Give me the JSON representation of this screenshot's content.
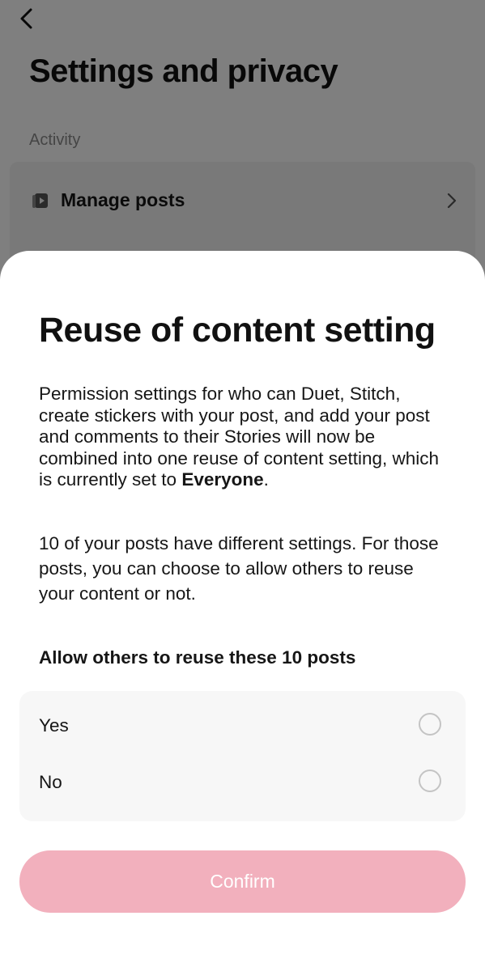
{
  "header": {
    "back_icon": "chevron-left-icon",
    "title": "Settings and privacy"
  },
  "activity": {
    "section_label": "Activity",
    "items": [
      {
        "label": "Manage posts",
        "icon": "video-posts-icon",
        "trailing_icon": "chevron-right-icon"
      }
    ]
  },
  "sheet": {
    "title": "Reuse of content setting",
    "description_prefix": "Permission settings for who can Duet, Stitch, create stickers with your post, and add your post and comments to their Stories will now be combined into one reuse of content setting, which is currently set to ",
    "description_value": "Everyone",
    "description_suffix": ".",
    "info": "10 of your posts have different settings. For those posts, you can choose to allow others to reuse your content or not.",
    "question": "Allow others to reuse these 10 posts",
    "options": [
      {
        "label": "Yes",
        "selected": false
      },
      {
        "label": "No",
        "selected": false
      }
    ],
    "confirm_label": "Confirm"
  },
  "colors": {
    "confirm_disabled_bg": "#f2b0bd",
    "overlay": "rgba(0,0,0,0.5)",
    "options_bg": "#f7f7f7"
  }
}
